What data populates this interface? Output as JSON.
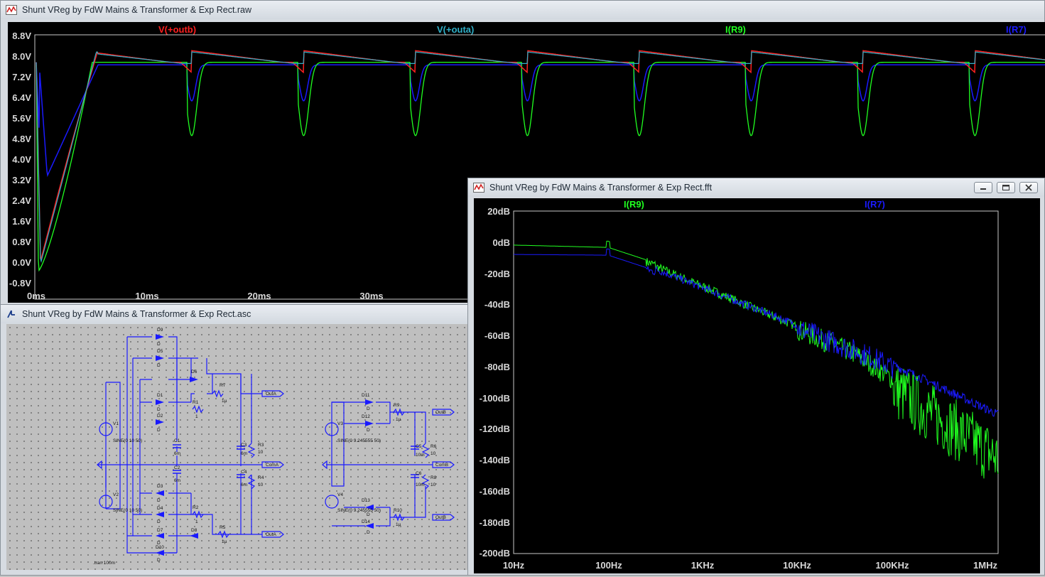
{
  "raw_window": {
    "title": "Shunt VReg by FdW Mains & Transformer & Exp Rect.raw",
    "traces": [
      {
        "name": "V(+outb)",
        "color": "#ff2020"
      },
      {
        "name": "V(+outa)",
        "color": "#30b0c8"
      },
      {
        "name": "I(R9)",
        "color": "#20ff20"
      },
      {
        "name": "I(R7)",
        "color": "#1a1aff"
      }
    ],
    "y_ticks": [
      "8.8V",
      "8.0V",
      "7.2V",
      "6.4V",
      "5.6V",
      "4.8V",
      "4.0V",
      "3.2V",
      "2.4V",
      "1.6V",
      "0.8V",
      "0.0V",
      "-0.8V"
    ],
    "x_ticks": [
      "0ms",
      "10ms",
      "20ms",
      "30ms"
    ]
  },
  "fft_window": {
    "title": "Shunt VReg by FdW Mains & Transformer & Exp Rect.fft",
    "traces": [
      {
        "name": "I(R9)",
        "color": "#20ff20"
      },
      {
        "name": "I(R7)",
        "color": "#1a1aff"
      }
    ],
    "y_ticks": [
      "20dB",
      "0dB",
      "-20dB",
      "-40dB",
      "-60dB",
      "-80dB",
      "-100dB",
      "-120dB",
      "-140dB",
      "-160dB",
      "-180dB",
      "-200dB"
    ],
    "x_ticks": [
      "10Hz",
      "100Hz",
      "1KHz",
      "10KHz",
      "100KHz",
      "1MHz"
    ],
    "buttons": {
      "minimize": "minimize",
      "restore": "restore",
      "close": "close"
    }
  },
  "asc_window": {
    "title": "Shunt VReg by FdW Mains & Transformer & Exp Rect.asc",
    "labels": {
      "D9": "D9",
      "D5": "D5",
      "D6": "D6",
      "D1": "D1",
      "D2": "D2",
      "D3": "D3",
      "D4": "D4",
      "D7": "D7",
      "D8": "D8",
      "D10": "D10",
      "D11": "D11",
      "D12": "D12",
      "D13": "D13",
      "D14": "D14",
      "R1": "R1",
      "R2": "R2",
      "R3": "R3",
      "R4": "R4",
      "R5": "R5",
      "R6": "R6",
      "R7": "R7",
      "R8": "R8",
      "R9": "R9",
      "R10": "R10",
      "C1": "C1",
      "C2": "C2",
      "C3": "C3",
      "C4": "C4",
      "C5": "C5",
      "C6": "C6",
      "V1": "V1",
      "V2": "V2",
      "V3": "V3",
      "V4": "V4",
      "D": "D",
      "one": "1",
      "ten": "10",
      "mu": "1µ",
      "sixm": "6m",
      "tenm": "10m",
      "src_a": "SINE(0 10 50)",
      "src_b": "SINE(0 9.245555 50)",
      "OutA": "OutA",
      "ComA": "ComA",
      "OutB": "OutB",
      "ComB": "ComB",
      "tran": ".tran 100m"
    }
  }
}
